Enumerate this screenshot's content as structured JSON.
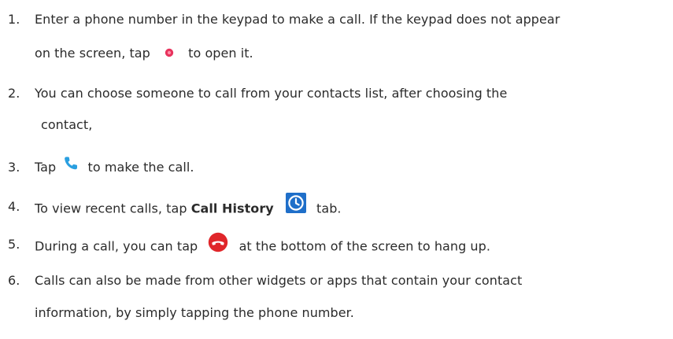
{
  "steps": [
    {
      "number": "1.",
      "text_a": "Enter a phone number in the keypad to make a call. If the keypad does not appear",
      "text_b_before": "on the screen, tap",
      "text_b_after": "to open it."
    },
    {
      "number": "2.",
      "text_a": "You can choose someone to call from your contacts list, after choosing the",
      "text_b": "contact,"
    },
    {
      "number": "3.",
      "text_before": "Tap",
      "text_after": "to make the call."
    },
    {
      "number": "4.",
      "text_before": "To view recent calls, tap",
      "bold_text": "Call History",
      "text_after": "tab."
    },
    {
      "number": "5.",
      "text_before": "During a call, you can tap",
      "text_after": "at the bottom of the screen to hang up."
    },
    {
      "number": "6.",
      "text_a": "Calls can also be made from other widgets or apps that contain your contact",
      "text_b": "information, by simply tapping the phone number."
    }
  ],
  "icons": {
    "keypad": "keypad-dot-icon",
    "call": "phone-handset-icon",
    "history": "clock-icon",
    "hangup": "end-call-icon"
  },
  "colors": {
    "keypad_icon": "#e8335d",
    "call_icon": "#2a9fe0",
    "history_icon": "#1f6fc9",
    "hangup_icon": "#e0262a",
    "text": "#2b2b2b"
  }
}
